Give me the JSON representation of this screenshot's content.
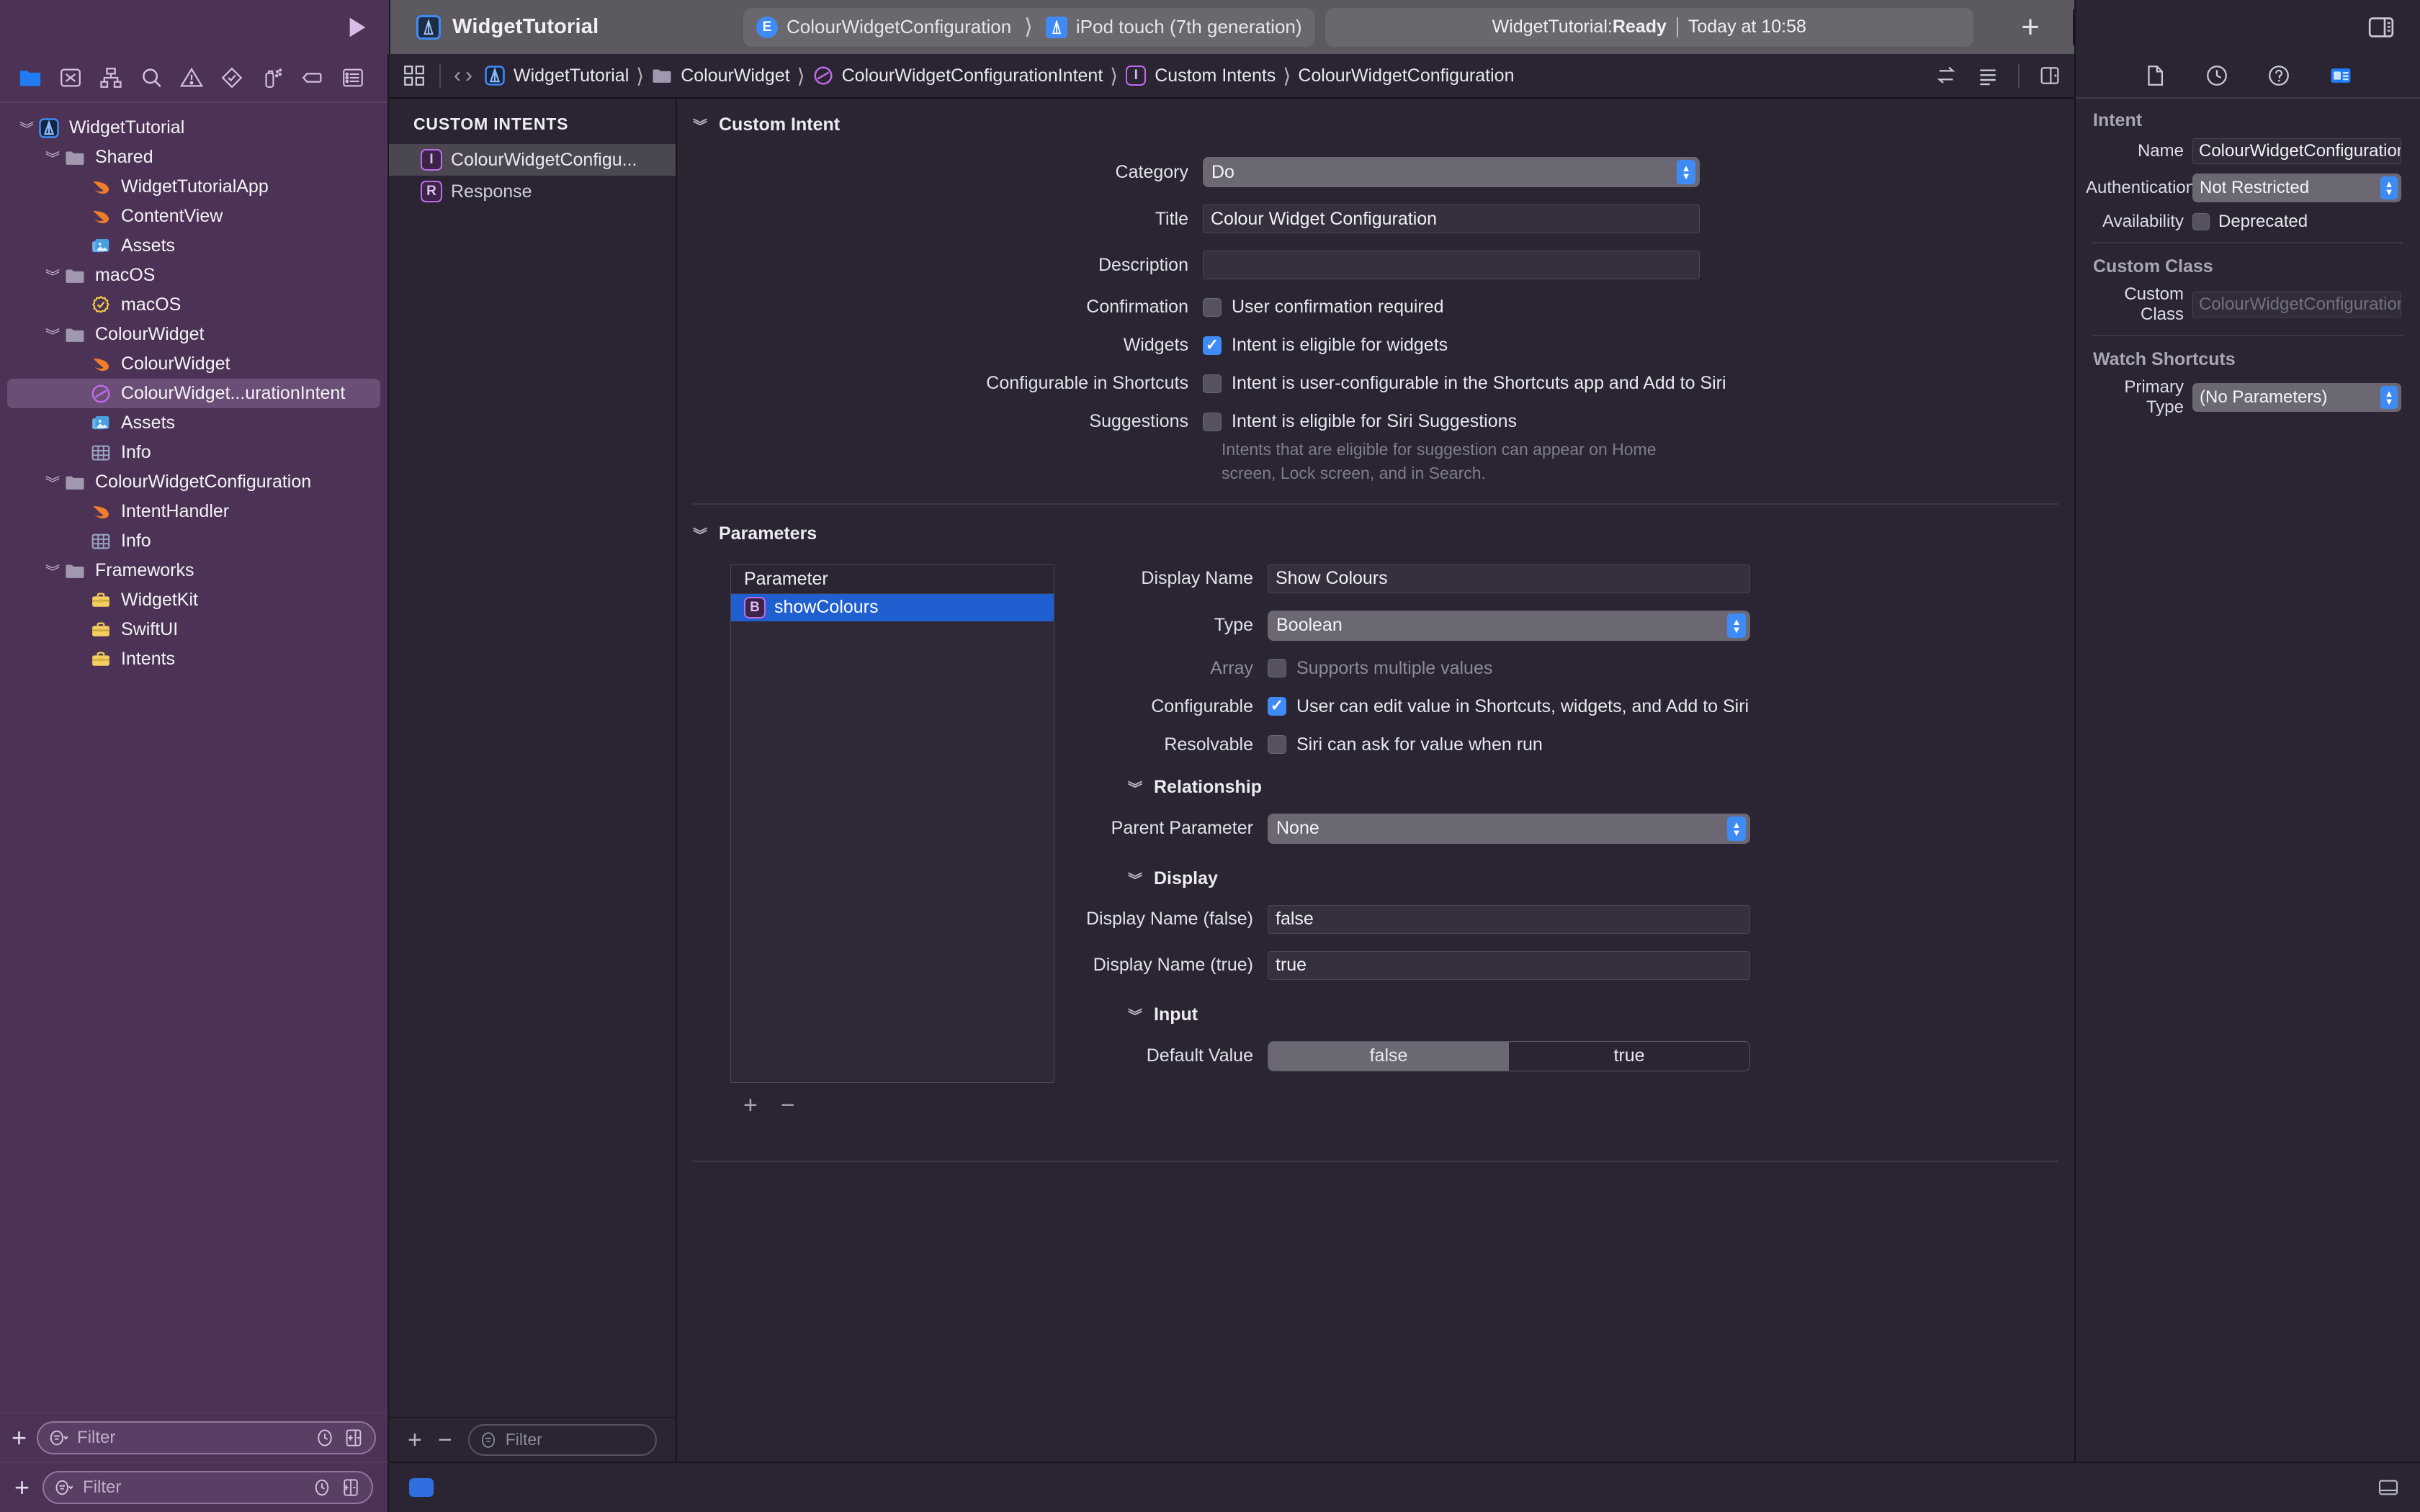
{
  "titlebar": {
    "project_name": "WidgetTutorial",
    "scheme": "ColourWidgetConfiguration",
    "destination": "iPod touch (7th generation)",
    "status_prefix": "WidgetTutorial: ",
    "status_state": "Ready",
    "status_suffix": "Today at 10:58",
    "add_label": "+",
    "sidebar_toggle_icon": "left-sidebar-icon",
    "run_icon": "run-play-icon",
    "inspector_toggle_icon": "right-sidebar-icon",
    "scheme_badge": "E"
  },
  "navigator": {
    "toolbar_icons": [
      "folder-project-navigator-icon",
      "source-control-navigator-icon",
      "symbol-navigator-icon",
      "find-navigator-icon",
      "issue-navigator-icon",
      "test-navigator-icon",
      "debug-navigator-icon",
      "breakpoint-navigator-icon",
      "report-navigator-icon"
    ],
    "tree": [
      {
        "label": "WidgetTutorial",
        "indent": 0,
        "icon": "xcode-project-icon",
        "disc": "open",
        "selected": false
      },
      {
        "label": "Shared",
        "indent": 1,
        "icon": "folder-icon",
        "disc": "open",
        "selected": false
      },
      {
        "label": "WidgetTutorialApp",
        "indent": 2,
        "icon": "swift-file-icon",
        "disc": "none",
        "selected": false
      },
      {
        "label": "ContentView",
        "indent": 2,
        "icon": "swift-file-icon",
        "disc": "none",
        "selected": false
      },
      {
        "label": "Assets",
        "indent": 2,
        "icon": "assets-catalog-icon",
        "disc": "none",
        "selected": false
      },
      {
        "label": "macOS",
        "indent": 1,
        "icon": "folder-icon",
        "disc": "open",
        "selected": false
      },
      {
        "label": "macOS",
        "indent": 2,
        "icon": "entitlements-icon",
        "disc": "none",
        "selected": false
      },
      {
        "label": "ColourWidget",
        "indent": 1,
        "icon": "folder-icon",
        "disc": "open",
        "selected": false
      },
      {
        "label": "ColourWidget",
        "indent": 2,
        "icon": "swift-file-icon",
        "disc": "none",
        "selected": false
      },
      {
        "label": "ColourWidget...urationIntent",
        "indent": 2,
        "icon": "intent-definition-icon",
        "disc": "none",
        "selected": true
      },
      {
        "label": "Assets",
        "indent": 2,
        "icon": "assets-catalog-icon",
        "disc": "none",
        "selected": false
      },
      {
        "label": "Info",
        "indent": 2,
        "icon": "plist-icon",
        "disc": "none",
        "selected": false
      },
      {
        "label": "ColourWidgetConfiguration",
        "indent": 1,
        "icon": "folder-icon",
        "disc": "open",
        "selected": false
      },
      {
        "label": "IntentHandler",
        "indent": 2,
        "icon": "swift-file-icon",
        "disc": "none",
        "selected": false
      },
      {
        "label": "Info",
        "indent": 2,
        "icon": "plist-icon",
        "disc": "none",
        "selected": false
      },
      {
        "label": "Frameworks",
        "indent": 1,
        "icon": "folder-icon",
        "disc": "open",
        "selected": false
      },
      {
        "label": "WidgetKit",
        "indent": 2,
        "icon": "framework-icon",
        "disc": "none",
        "selected": false
      },
      {
        "label": "SwiftUI",
        "indent": 2,
        "icon": "framework-icon",
        "disc": "none",
        "selected": false
      },
      {
        "label": "Intents",
        "indent": 2,
        "icon": "framework-icon",
        "disc": "none",
        "selected": false
      }
    ],
    "bottom": {
      "add_label": "+",
      "filter_placeholder": "Filter",
      "recent_icon": "clock-filter-icon",
      "sourcecontrol_icon": "source-control-filter-icon"
    }
  },
  "breadcrumb": {
    "grid_icon": "related-items-icon",
    "back_label": "‹",
    "forward_label": "›",
    "items": [
      {
        "label": "WidgetTutorial",
        "icon": "xcode-project-icon"
      },
      {
        "label": "ColourWidget",
        "icon": "folder-icon"
      },
      {
        "label": "ColourWidgetConfigurationIntent",
        "icon": "intent-definition-icon"
      },
      {
        "label": "Custom Intents",
        "icon": "intent-badge-icon"
      },
      {
        "label": "ColourWidgetConfiguration",
        "icon": ""
      }
    ],
    "right_icons": [
      "compare-versions-icon",
      "list-view-icon",
      "assistant-editor-icon"
    ]
  },
  "intent_list": {
    "header": "CUSTOM INTENTS",
    "rows": [
      {
        "label": "ColourWidgetConfigu...",
        "badge": "I",
        "selected": true
      },
      {
        "label": "Response",
        "badge": "R",
        "selected": false
      }
    ],
    "bottom": {
      "add_label": "+",
      "remove_label": "−",
      "filter_placeholder": "Filter",
      "filter_icon": "filter-icon"
    }
  },
  "custom_intent": {
    "section_title": "Custom Intent",
    "category_label": "Category",
    "category_value": "Do",
    "title_label": "Title",
    "title_value": "Colour Widget Configuration",
    "description_label": "Description",
    "description_value": "",
    "confirmation_label": "Confirmation",
    "confirmation_text": "User confirmation required",
    "confirmation_checked": false,
    "widgets_label": "Widgets",
    "widgets_text": "Intent is eligible for widgets",
    "widgets_checked": true,
    "shortcuts_label": "Configurable in Shortcuts",
    "shortcuts_text": "Intent is user-configurable in the Shortcuts app and Add to Siri",
    "shortcuts_checked": false,
    "suggestions_label": "Suggestions",
    "suggestions_text": "Intent is eligible for Siri Suggestions",
    "suggestions_checked": false,
    "suggestions_help": "Intents that are eligible for suggestion can appear on Home screen, Lock screen, and in Search."
  },
  "parameters": {
    "section_title": "Parameters",
    "column_header": "Parameter",
    "rows": [
      {
        "name": "showColours",
        "badge": "B",
        "selected": true
      }
    ],
    "add_label": "+",
    "remove_label": "−",
    "detail": {
      "display_name_label": "Display Name",
      "display_name_value": "Show Colours",
      "type_label": "Type",
      "type_value": "Boolean",
      "array_label": "Array",
      "array_text": "Supports multiple values",
      "array_checked": false,
      "configurable_label": "Configurable",
      "configurable_text": "User can edit value in Shortcuts, widgets, and Add to Siri",
      "configurable_checked": true,
      "resolvable_label": "Resolvable",
      "resolvable_text": "Siri can ask for value when run",
      "resolvable_checked": false,
      "relationship_title": "Relationship",
      "parent_parameter_label": "Parent Parameter",
      "parent_parameter_value": "None",
      "display_title": "Display",
      "display_false_label": "Display Name (false)",
      "display_false_value": "false",
      "display_true_label": "Display Name (true)",
      "display_true_value": "true",
      "input_title": "Input",
      "default_value_label": "Default Value",
      "default_option_false": "false",
      "default_option_true": "true",
      "default_selected": "false"
    }
  },
  "inspector": {
    "tabs": [
      "file-inspector-icon",
      "history-inspector-icon",
      "quick-help-icon",
      "attributes-inspector-icon"
    ],
    "active_tab": "attributes-inspector-icon",
    "intent_section": "Intent",
    "name_label": "Name",
    "name_value": "ColourWidgetConfiguration",
    "authentication_label": "Authentication",
    "authentication_value": "Not Restricted",
    "availability_label": "Availability",
    "availability_text": "Deprecated",
    "availability_checked": false,
    "custom_class_section": "Custom Class",
    "custom_class_label": "Custom Class",
    "custom_class_placeholder": "ColourWidgetConfigurationInte",
    "watch_shortcuts_section": "Watch Shortcuts",
    "primary_type_label": "Primary Type",
    "primary_type_value": "(No Parameters)"
  },
  "bottombar": {
    "add_label": "+",
    "filter_placeholder": "Filter",
    "filter_icon": "filter-dropdown-icon",
    "recent_icon": "clock-filter-icon",
    "hierarchy_icon": "hierarchy-filter-icon",
    "debug_chip": "debug-area-chip",
    "debug_toggle_icon": "debug-area-toggle-icon"
  },
  "colors": {
    "navigator_bg": "#4c3355",
    "editor_bg": "#2a2433",
    "accent_blue": "#3f8bf5",
    "selection_blue": "#1f5fd0",
    "intent_purple": "#c06bea",
    "swift_orange": "#f07d2c",
    "framework_yellow": "#f5cf5e"
  }
}
